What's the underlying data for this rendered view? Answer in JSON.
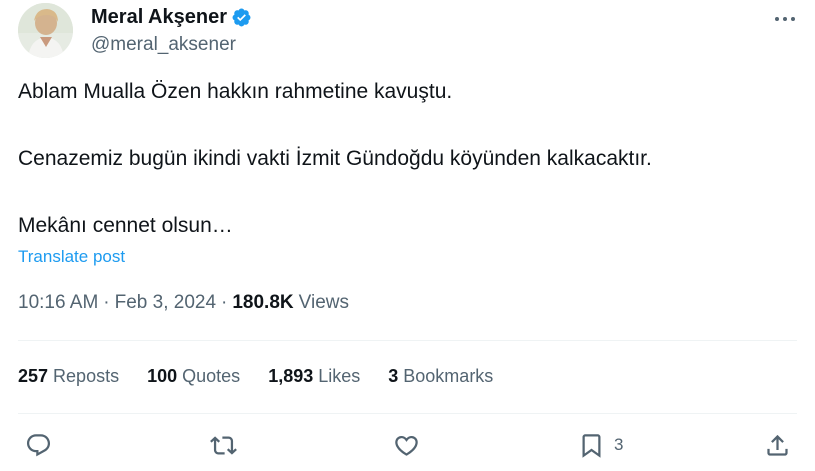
{
  "author": {
    "name": "Meral Akşener",
    "handle": "@meral_aksener",
    "avatar_icon": "profile-photo"
  },
  "tweet": {
    "line1": "Ablam Mualla Özen hakkın rahmetine kavuştu.",
    "line2": "Cenazemiz bugün ikindi vakti İzmit Gündoğdu köyünden kalkacaktır.",
    "line3": "Mekânı cennet olsun…",
    "translate_label": "Translate post"
  },
  "meta": {
    "time": "10:16 AM",
    "separator": "·",
    "date": "Feb 3, 2024",
    "views_count": "180.8K",
    "views_label": "Views"
  },
  "stats": {
    "reposts_count": "257",
    "reposts_label": "Reposts",
    "quotes_count": "100",
    "quotes_label": "Quotes",
    "likes_count": "1,893",
    "likes_label": "Likes",
    "bookmarks_count": "3",
    "bookmarks_label": "Bookmarks"
  },
  "actions": {
    "bookmark_count": "3",
    "icons": [
      "reply-icon",
      "repost-icon",
      "like-icon",
      "bookmark-icon",
      "share-icon"
    ]
  },
  "colors": {
    "link": "#1d9bf0",
    "secondary_text": "#536471",
    "primary_text": "#0f1419",
    "verified": "#1d9bf0"
  }
}
